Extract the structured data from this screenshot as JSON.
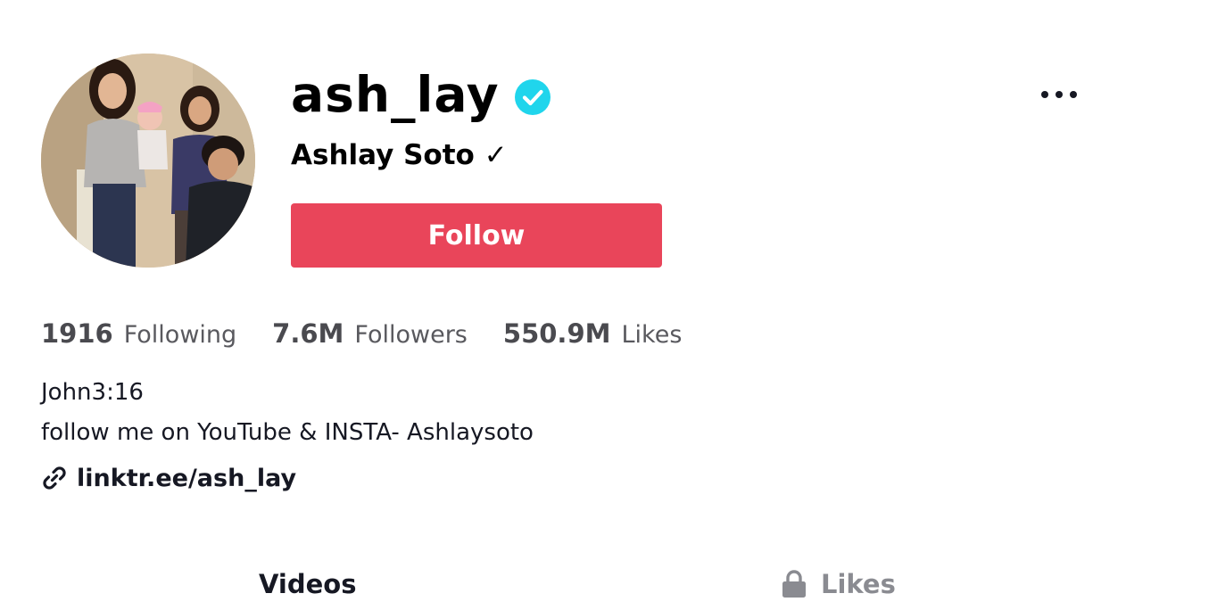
{
  "profile": {
    "username": "ash_lay",
    "display_name": "Ashlay Soto ✓",
    "follow_label": "Follow"
  },
  "stats": {
    "following": {
      "count": "1916",
      "label": "Following"
    },
    "followers": {
      "count": "7.6M",
      "label": "Followers"
    },
    "likes": {
      "count": "550.9M",
      "label": "Likes"
    }
  },
  "bio": {
    "line1": "John3:16",
    "line2": "follow me on YouTube & INSTA- Ashlaysoto"
  },
  "link": {
    "text": "linktr.ee/ash_lay",
    "icon": "link-icon"
  },
  "tabs": [
    {
      "label": "Videos",
      "icon": null
    },
    {
      "label": "Likes",
      "icon": "lock-icon"
    }
  ],
  "colors": {
    "follow_button": "#e9455a",
    "verified_badge": "#20d5ec",
    "inactive_tab": "#8a8b91"
  },
  "icons": {
    "verified": "verified-badge-icon",
    "more": "more-options-icon",
    "lock": "lock-icon"
  }
}
